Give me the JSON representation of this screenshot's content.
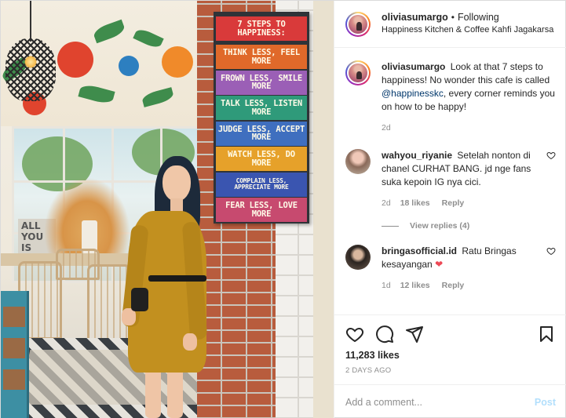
{
  "post": {
    "sign": {
      "title": "7 STEPS TO HAPPINESS:",
      "lines": [
        {
          "text": "THINK LESS, FEEL MORE",
          "color": "#e0692a"
        },
        {
          "text": "FROWN LESS, SMILE MORE",
          "color": "#9b5fb6"
        },
        {
          "text": "TALK LESS, LISTEN MORE",
          "color": "#2f9a7a"
        },
        {
          "text": "JUDGE LESS, ACCEPT MORE",
          "color": "#3f6fbf"
        },
        {
          "text": "WATCH LESS, DO MORE",
          "color": "#e6a12a"
        },
        {
          "text": "COMPLAIN LESS, APPRECIATE MORE",
          "color": "#3a55b0"
        },
        {
          "text": "FEAR LESS, LOVE MORE",
          "color": "#c74a6f"
        }
      ],
      "title_color": "#d93a3a"
    },
    "wall_text": "ALL YOU IS"
  },
  "header": {
    "username": "oliviasumargo",
    "separator": "•",
    "follow_status": "Following",
    "location": "Happiness Kitchen & Coffee Kahfi Jagakarsa"
  },
  "caption": {
    "username": "oliviasumargo",
    "text_before": "Look at that 7 steps to happiness! No wonder this cafe is called",
    "mention": "@happinesskc",
    "text_after": ", every corner reminds you on how to be happy!",
    "age": "2d"
  },
  "comments": [
    {
      "username": "wahyou_riyanie",
      "text": "Setelah nonton di chanel CURHAT BANG. jd nge fans suka kepoin IG nya cici.",
      "age": "2d",
      "likes": "18 likes",
      "reply": "Reply",
      "view_replies": "View replies (4)"
    },
    {
      "username": "bringasofficial.id",
      "text": "Ratu Bringas kesayangan",
      "emoji": "❤",
      "age": "1d",
      "likes": "12 likes",
      "reply": "Reply"
    }
  ],
  "actions": {
    "likes": "11,283 likes",
    "time": "2 DAYS AGO"
  },
  "composer": {
    "placeholder": "Add a comment...",
    "post_label": "Post"
  },
  "colors": {
    "mention": "#00376b",
    "secondary_text": "#8e8e8e",
    "post_button": "#b2dffc",
    "heart_red": "#ed4956"
  }
}
